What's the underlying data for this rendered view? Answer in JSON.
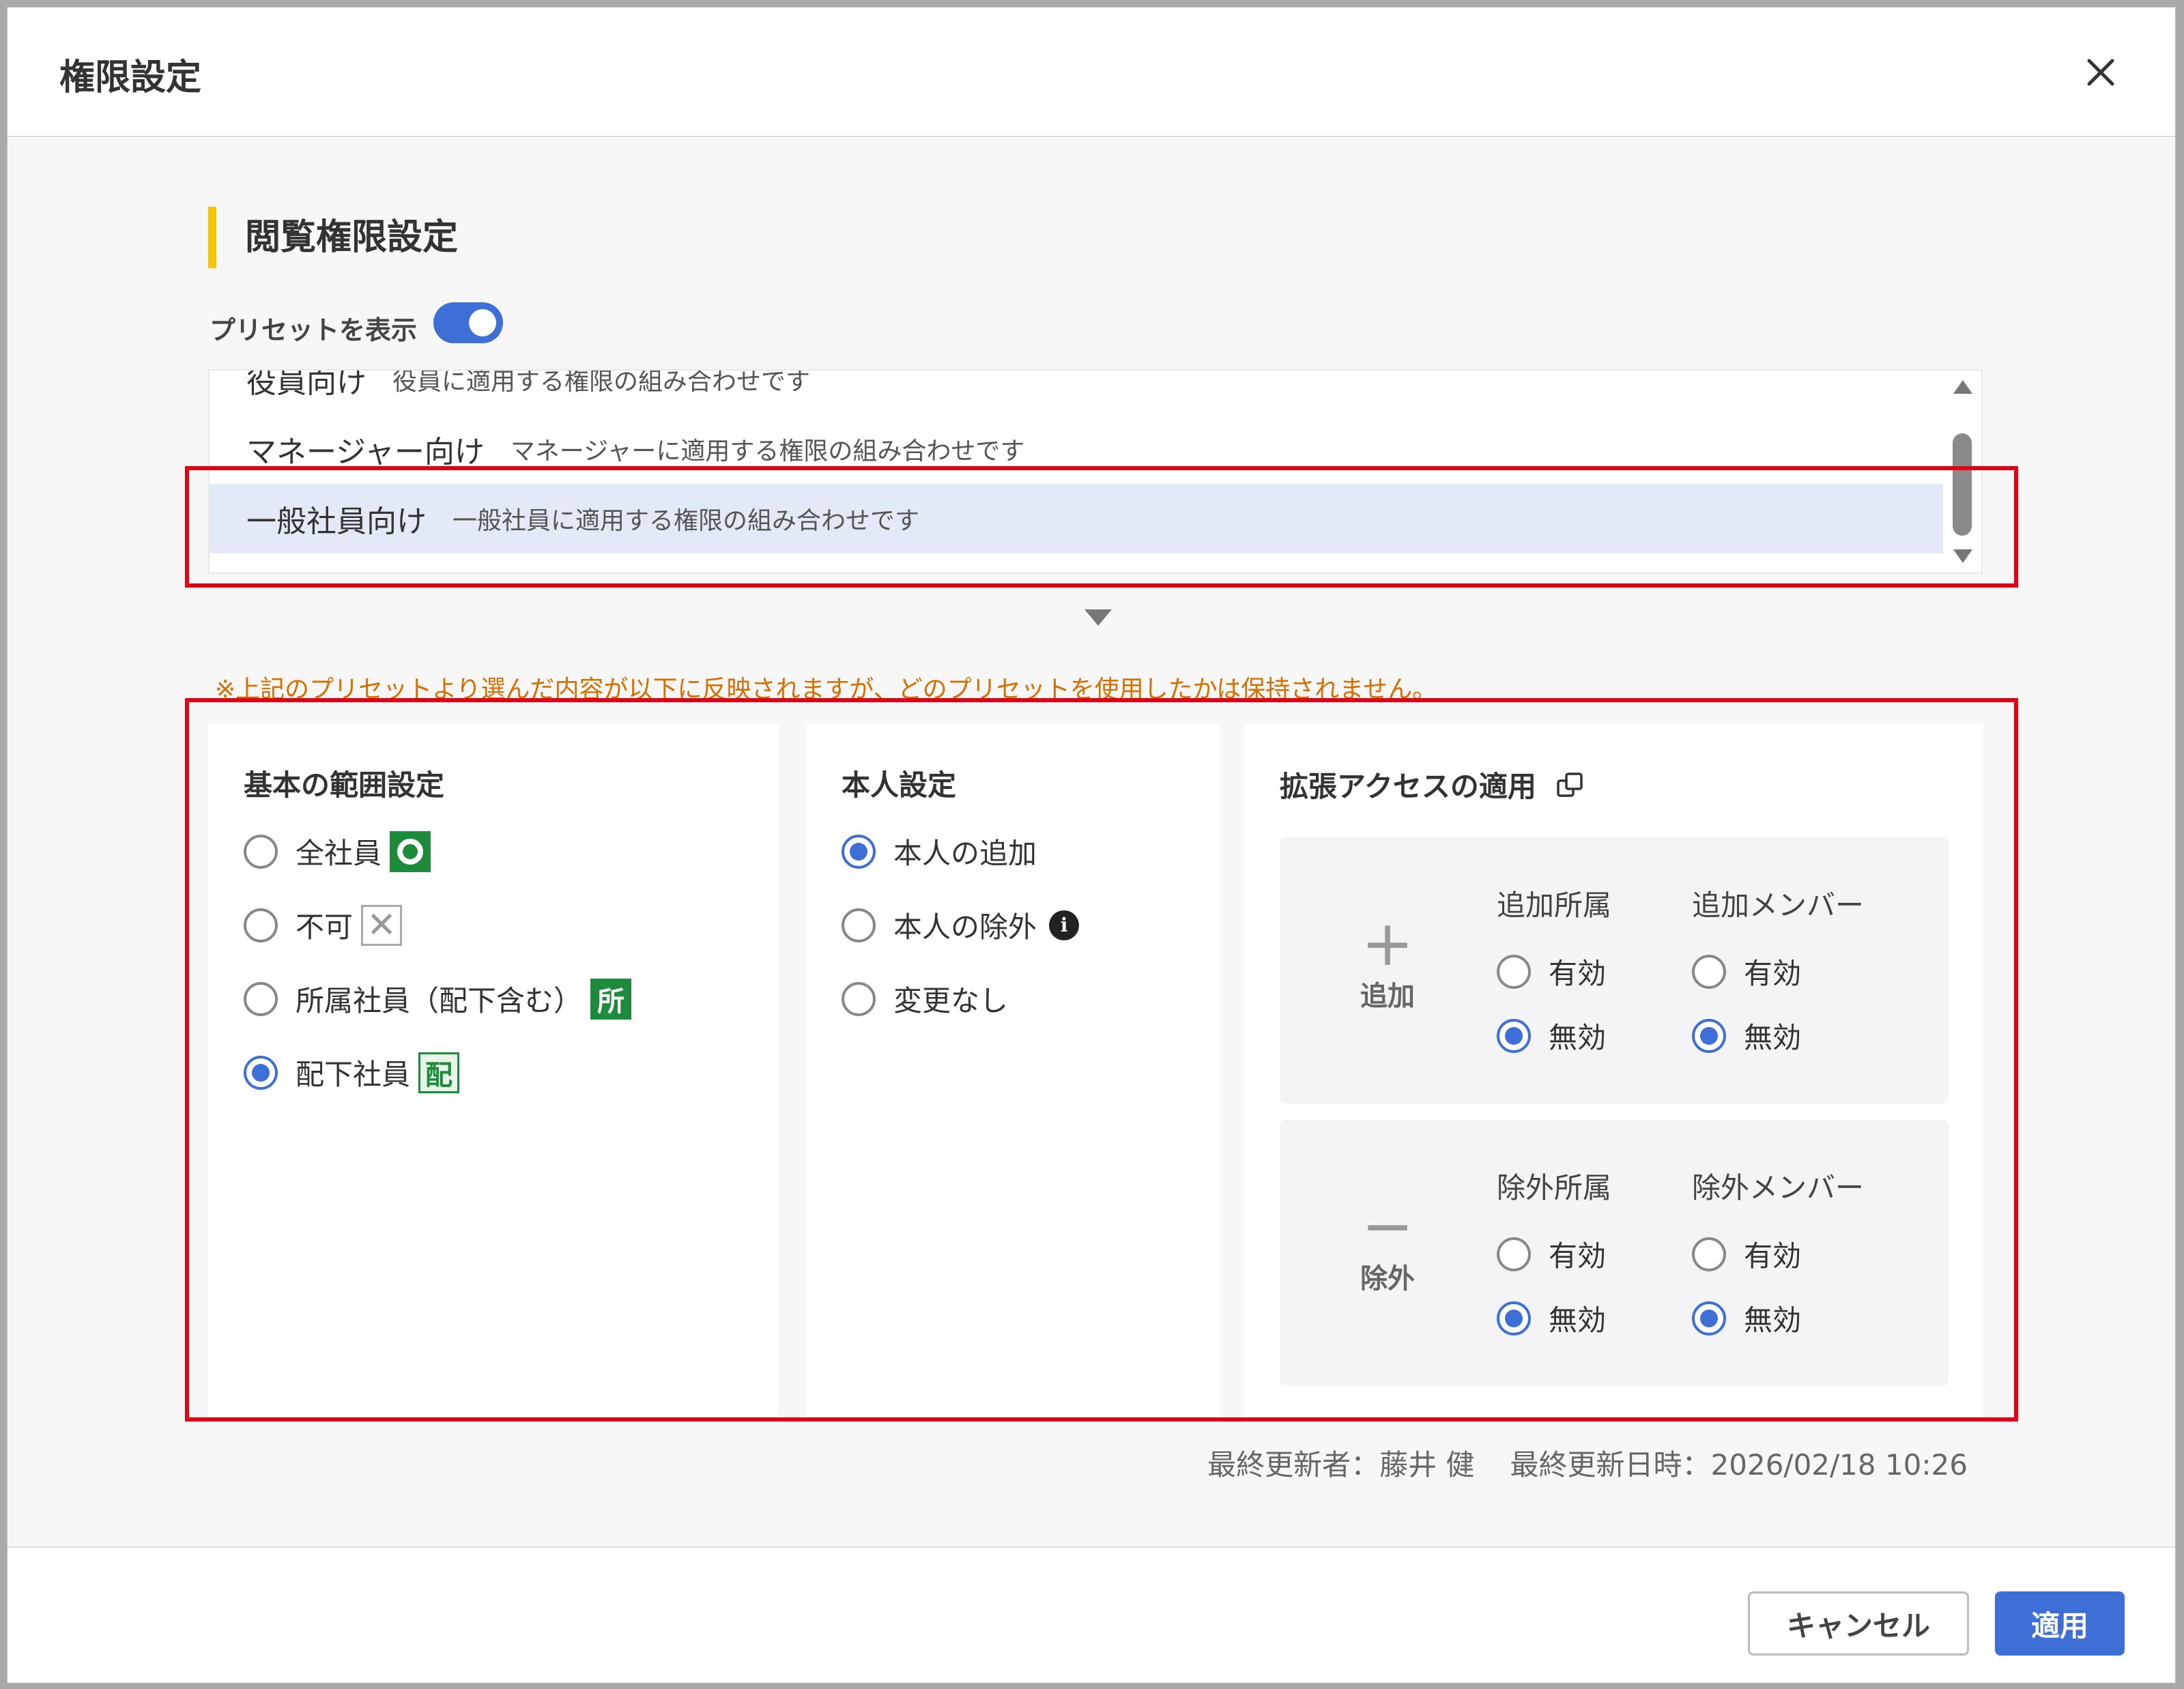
{
  "dialog": {
    "title": "権限設定"
  },
  "section": {
    "title": "閲覧権限設定"
  },
  "preset": {
    "toggle_label": "プリセットを表示",
    "toggle_on": true,
    "items": [
      {
        "name": "役員向け",
        "desc": "役員に適用する権限の組み合わせです"
      },
      {
        "name": "マネージャー向け",
        "desc": "マネージャーに適用する権限の組み合わせです"
      },
      {
        "name": "一般社員向け",
        "desc": "一般社員に適用する権限の組み合わせです",
        "selected": true
      }
    ]
  },
  "note": "※上記のプリセットより選んだ内容が以下に反映されますが、どのプリセットを使用したかは保持されません。",
  "basic": {
    "title": "基本の範囲設定",
    "options": [
      {
        "label": "全社員",
        "badge": "circle",
        "checked": false
      },
      {
        "label": "不可",
        "badge": "x",
        "checked": false
      },
      {
        "label": "所属社員（配下含む）",
        "badge": "所",
        "checked": false
      },
      {
        "label": "配下社員",
        "badge": "配",
        "checked": true
      }
    ]
  },
  "self": {
    "title": "本人設定",
    "options": [
      {
        "label": "本人の追加",
        "checked": true
      },
      {
        "label": "本人の除外",
        "checked": false,
        "info": "i"
      },
      {
        "label": "変更なし",
        "checked": false
      }
    ]
  },
  "ext": {
    "title": "拡張アクセスの適用",
    "add": {
      "mark": "+",
      "label": "追加",
      "col1": {
        "header": "追加所属",
        "enabled": "有効",
        "disabled": "無効"
      },
      "col2": {
        "header": "追加メンバー",
        "enabled": "有効",
        "disabled": "無効"
      }
    },
    "exclude": {
      "mark": "−",
      "label": "除外",
      "col1": {
        "header": "除外所属",
        "enabled": "有効",
        "disabled": "無効"
      },
      "col2": {
        "header": "除外メンバー",
        "enabled": "有効",
        "disabled": "無効"
      }
    }
  },
  "meta": {
    "updater_label": "最終更新者：",
    "updater": "藤井 健",
    "updated_label": "最終更新日時：",
    "updated": "2026/02/18 10:26"
  },
  "buttons": {
    "cancel": "キャンセル",
    "apply": "適用"
  },
  "colors": {
    "accent": "#3d6fd7",
    "highlight": "#e60012",
    "section_bar": "#f6c400",
    "note": "#d66f00",
    "badge_green": "#1e8a3c"
  }
}
